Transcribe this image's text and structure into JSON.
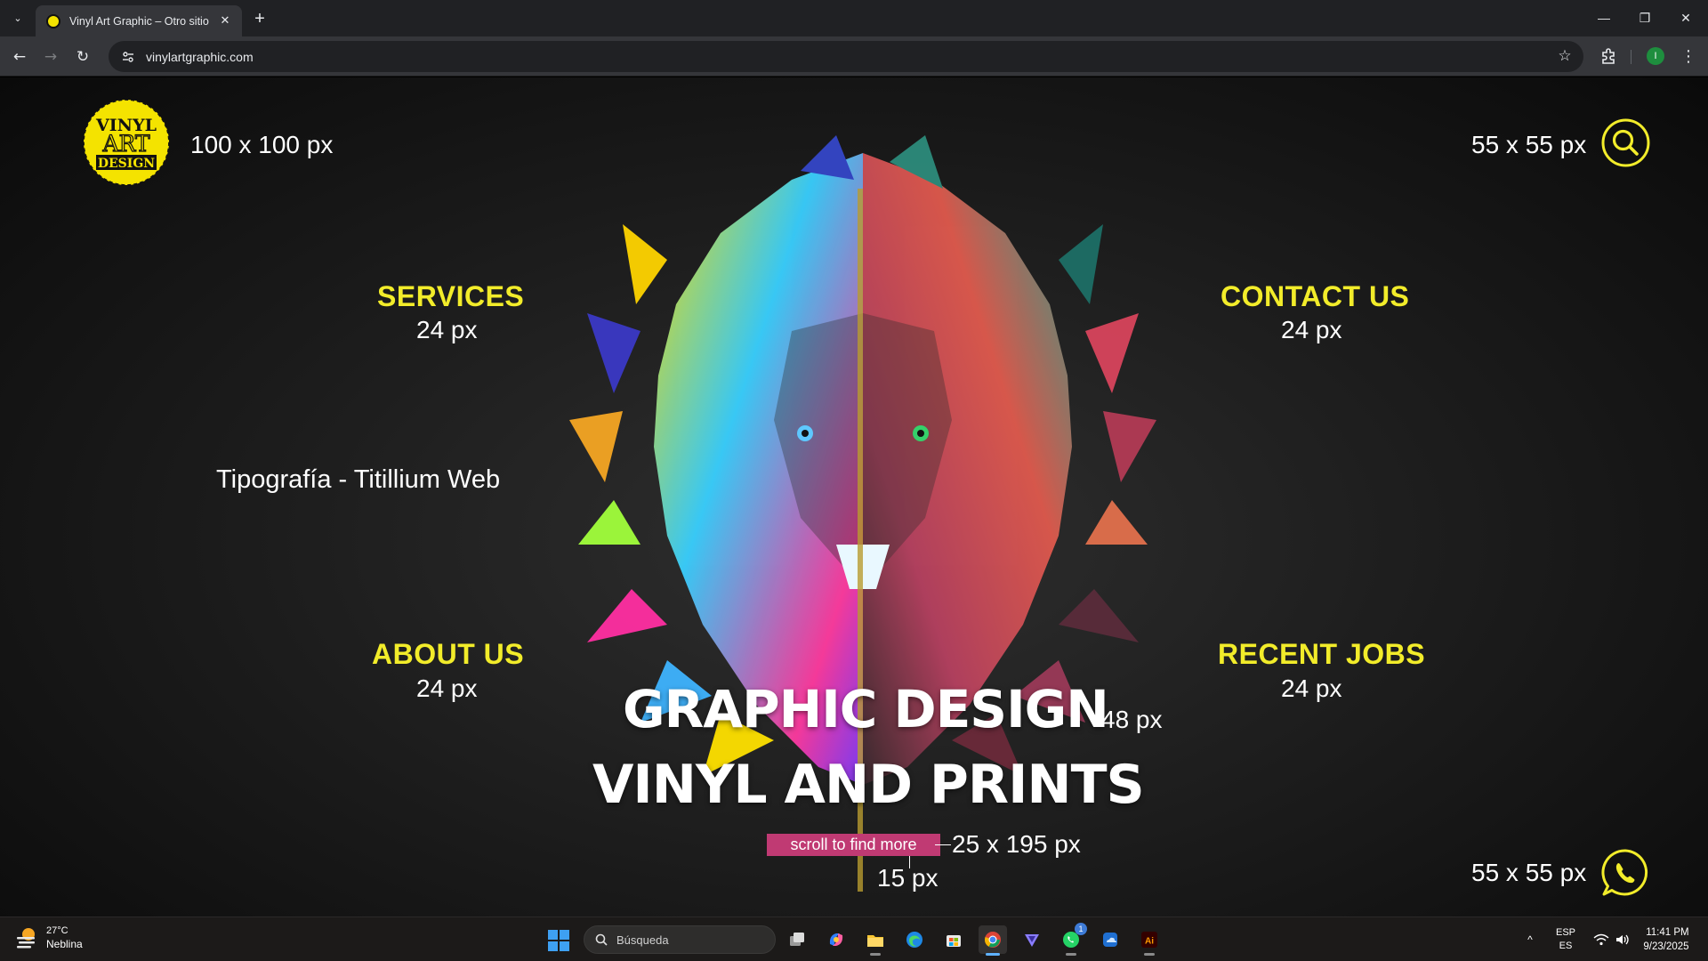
{
  "browser": {
    "tab_title": "Vinyl Art Graphic – Otro sitio realizado con WordPress",
    "url": "vinylartgraphic.com",
    "profile_initial": "I",
    "tab_close_glyph": "✕",
    "new_tab_glyph": "+",
    "tab_menu_glyph": "⌄",
    "minimize_glyph": "—",
    "restore_glyph": "❐",
    "close_glyph": "✕",
    "back_glyph": "←",
    "forward_glyph": "→",
    "reload_glyph": "↻",
    "star_glyph": "☆",
    "menu_glyph": "⋮"
  },
  "page": {
    "logo": {
      "line1": "VINYL",
      "line2": "ART",
      "line3": "DESIGN",
      "size_note": "100 x 100 px"
    },
    "search_size_note": "55 x 55 px",
    "whatsapp_size_note": "55 x 55 px",
    "typography_note": "Tipografía - Titillium Web",
    "nav": {
      "services": {
        "label": "SERVICES",
        "size_note": "24 px"
      },
      "contact": {
        "label": "CONTACT US",
        "size_note": "24 px"
      },
      "about": {
        "label": "ABOUT US",
        "size_note": "24 px"
      },
      "recent": {
        "label": "RECENT JOBS",
        "size_note": "24 px"
      }
    },
    "hero": {
      "line1": "GRAPHIC DESIGN",
      "line1_size_note": "48 px",
      "line2": "VINYL AND PRINTS",
      "scroll_label": "scroll to find more",
      "scroll_size_note": "25 x 195 px",
      "scroll_font_note": "15 px"
    }
  },
  "taskbar": {
    "weather_temp": "27°C",
    "weather_condition": "Neblina",
    "search_placeholder": "Búsqueda",
    "lang_top": "ESP",
    "lang_bottom": "ES",
    "time": "11:41 PM",
    "date": "9/23/2025",
    "whatsapp_badge": "1",
    "tray_chevron": "^",
    "apps": [
      "task-view",
      "copilot",
      "file-explorer",
      "edge",
      "store",
      "chrome",
      "proton-vpn",
      "whatsapp",
      "onedrive-app",
      "illustrator"
    ]
  },
  "colors": {
    "accent_yellow": "#f2ec2a",
    "scroll_button": "#c03a73",
    "page_background": "#1e1e1e"
  }
}
